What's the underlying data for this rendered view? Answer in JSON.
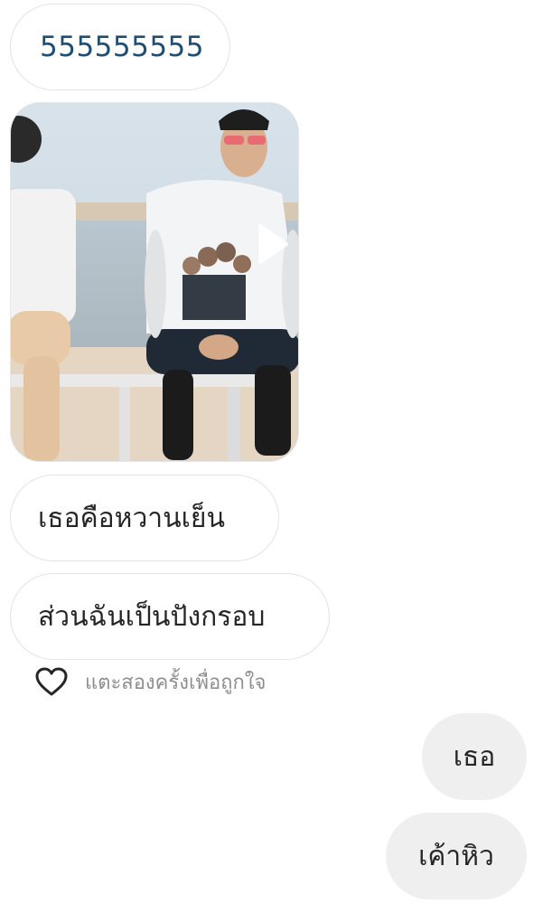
{
  "messages": {
    "incoming": [
      {
        "text": "555555555"
      },
      {
        "text": "เธอคือหวานเย็น"
      },
      {
        "text": "ส่วนฉันเป็นปังกรอบ"
      }
    ],
    "like_hint": "แตะสองครั้งเพื่อถูกใจ",
    "outgoing": [
      {
        "text": "เธอ"
      },
      {
        "text": "เค้าหิว"
      }
    ]
  },
  "icons": {
    "play": "play-icon",
    "like": "heart-icon"
  },
  "colors": {
    "incoming_bubble_border": "#e3e3e3",
    "outgoing_bubble_bg": "#efefef",
    "link_text": "#1d4e76",
    "hint_text": "#8e8e8e"
  }
}
